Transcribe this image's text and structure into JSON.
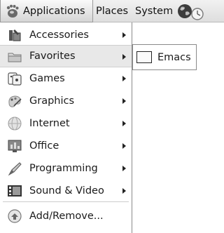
{
  "panel": {
    "applications_label": "Applications",
    "places_label": "Places",
    "system_label": "System",
    "icons": [
      "gnome-foot-icon",
      "globe-icon",
      "clock-icon"
    ]
  },
  "menu": {
    "items": [
      {
        "label": "Accessories",
        "icon": "accessories-icon",
        "has_submenu": true
      },
      {
        "label": "Favorites",
        "icon": "folder-icon",
        "has_submenu": true,
        "selected": true
      },
      {
        "label": "Games",
        "icon": "games-icon",
        "has_submenu": true
      },
      {
        "label": "Graphics",
        "icon": "graphics-icon",
        "has_submenu": true
      },
      {
        "label": "Internet",
        "icon": "internet-icon",
        "has_submenu": true
      },
      {
        "label": "Office",
        "icon": "office-icon",
        "has_submenu": true
      },
      {
        "label": "Programming",
        "icon": "programming-icon",
        "has_submenu": true
      },
      {
        "label": "Sound & Video",
        "icon": "sound-video-icon",
        "has_submenu": true
      },
      {
        "label": "Add/Remove...",
        "icon": "add-remove-icon",
        "has_submenu": false
      }
    ]
  },
  "submenu": {
    "items": [
      {
        "label": "Emacs",
        "icon": "emacs-window-icon"
      }
    ]
  },
  "colors": {
    "selected_bg": "#e8e8e8",
    "panel_bg": "#e6e6e6",
    "menu_bg": "#ffffff"
  }
}
